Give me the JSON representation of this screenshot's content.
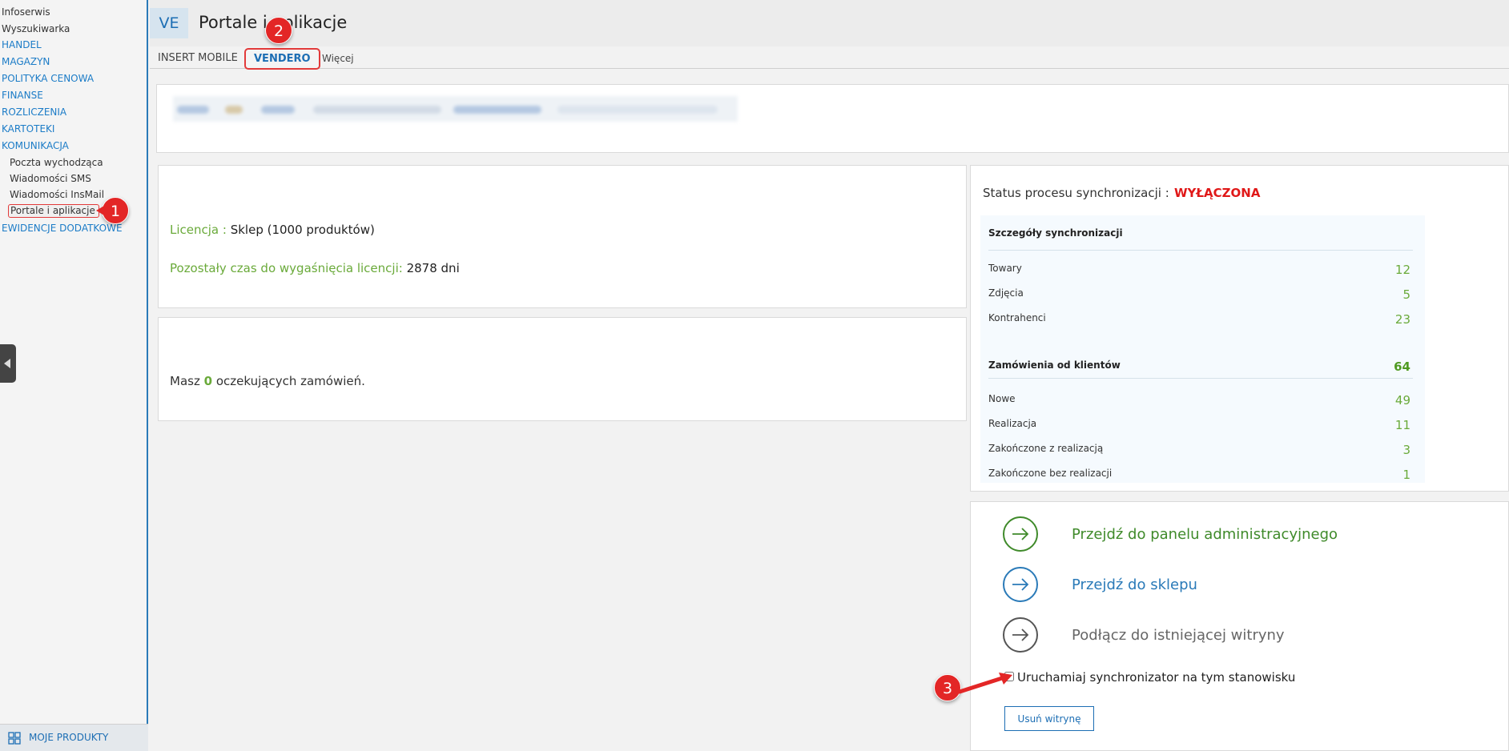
{
  "sidebar": {
    "items": [
      {
        "label": "Infoserwis"
      },
      {
        "label": "Wyszukiwarka"
      },
      {
        "label": "HANDEL"
      },
      {
        "label": "MAGAZYN"
      },
      {
        "label": "POLITYKA CENOWA"
      },
      {
        "label": "FINANSE"
      },
      {
        "label": "ROZLICZENIA"
      },
      {
        "label": "KARTOTEKI"
      },
      {
        "label": "KOMUNIKACJA"
      },
      {
        "label": "Poczta wychodząca"
      },
      {
        "label": "Wiadomości SMS"
      },
      {
        "label": "Wiadomości InsMail"
      },
      {
        "label": "Portale i aplikacje"
      },
      {
        "label": "EWIDENCJE DODATKOWE"
      }
    ],
    "bottom_label": "MOJE PRODUKTY",
    "bottom_icon": "grid-icon"
  },
  "header": {
    "badge": "VE",
    "title": "Portale i aplikacje"
  },
  "tabs": [
    {
      "label": "INSERT MOBILE"
    },
    {
      "label": "VENDERO"
    },
    {
      "label": "Więcej"
    }
  ],
  "license": {
    "license_label": "Licencja :",
    "license_value": "Sklep (1000 produktów)",
    "remaining_label": "Pozostały czas do wygaśnięcia licencji:",
    "remaining_value": "2878 dni"
  },
  "orders": {
    "prefix": "Masz",
    "count": "0",
    "suffix": "oczekujących zamówień."
  },
  "sync": {
    "title": "Status procesu synchronizacji :",
    "status": "WYŁĄCZONA",
    "details_title": "Szczegóły synchronizacji",
    "details": [
      {
        "label": "Towary",
        "value": "12"
      },
      {
        "label": "Zdjęcia",
        "value": "5"
      },
      {
        "label": "Kontrahenci",
        "value": "23"
      }
    ],
    "orders_title": "Zamówienia od klientów",
    "orders_total": "64",
    "orders": [
      {
        "label": "Nowe",
        "value": "49"
      },
      {
        "label": "Realizacja",
        "value": "11"
      },
      {
        "label": "Zakończone z realizacją",
        "value": "3"
      },
      {
        "label": "Zakończone bez realizacji",
        "value": "1"
      }
    ]
  },
  "actions": [
    {
      "label": "Przejdź do panelu administracyjnego",
      "color": "#3f8a2a"
    },
    {
      "label": "Przejdź do sklepu",
      "color": "#2a7ab8"
    },
    {
      "label": "Podłącz do istniejącej witryny",
      "color": "#555555"
    }
  ],
  "checkbox_label": "Uruchamiaj synchronizator na tym stanowisku",
  "remove_button": "Usuń witrynę",
  "markers": [
    "1",
    "2",
    "3"
  ],
  "colors": {
    "accent": "#1c6eb4",
    "success": "#6aaa3a",
    "danger": "#e01818",
    "marker": "#e32626"
  }
}
